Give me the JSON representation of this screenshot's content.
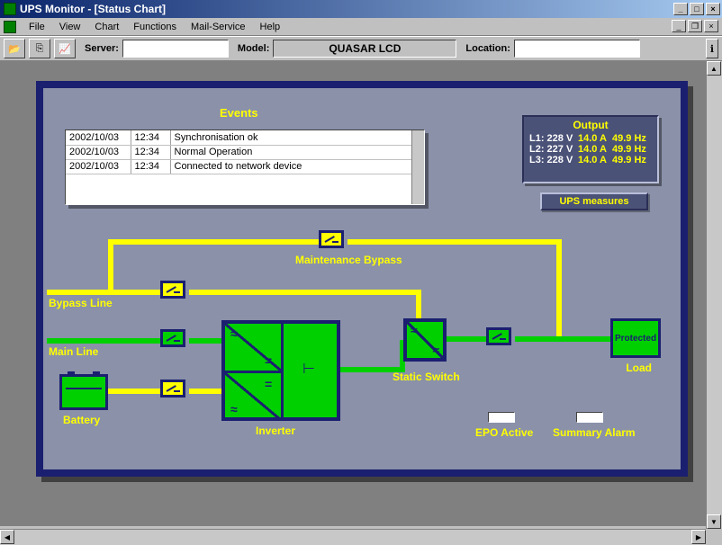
{
  "window": {
    "title": "UPS Monitor - [Status Chart]"
  },
  "menu": {
    "file": "File",
    "view": "View",
    "chart": "Chart",
    "functions": "Functions",
    "mail": "Mail-Service",
    "help": "Help"
  },
  "toolbar": {
    "server_label": "Server:",
    "server_value": "",
    "model_label": "Model:",
    "model_value": "QUASAR LCD",
    "location_label": "Location:",
    "location_value": ""
  },
  "panel": {
    "events_heading": "Events",
    "events": [
      {
        "date": "2002/10/03",
        "time": "12:34",
        "msg": "Synchronisation ok"
      },
      {
        "date": "2002/10/03",
        "time": "12:34",
        "msg": "Normal Operation"
      },
      {
        "date": "2002/10/03",
        "time": "12:34",
        "msg": "Connected to network device"
      }
    ],
    "output": {
      "title": "Output",
      "rows": [
        {
          "label": "L1: 228 V",
          "amps": "14.0 A",
          "hz": "49.9 Hz"
        },
        {
          "label": "L2: 227 V",
          "amps": "14.0 A",
          "hz": "49.9 Hz"
        },
        {
          "label": "L3: 228 V",
          "amps": "14.0 A",
          "hz": "49.9 Hz"
        }
      ]
    },
    "measures_btn": "UPS measures",
    "labels": {
      "maint_bypass": "Maintenance Bypass",
      "bypass_line": "Bypass Line",
      "main_line": "Main Line",
      "battery": "Battery",
      "inverter": "Inverter",
      "static_switch": "Static Switch",
      "load": "Load",
      "load_box": "Protected",
      "epo": "EPO Active",
      "summary_alarm": "Summary Alarm"
    }
  }
}
